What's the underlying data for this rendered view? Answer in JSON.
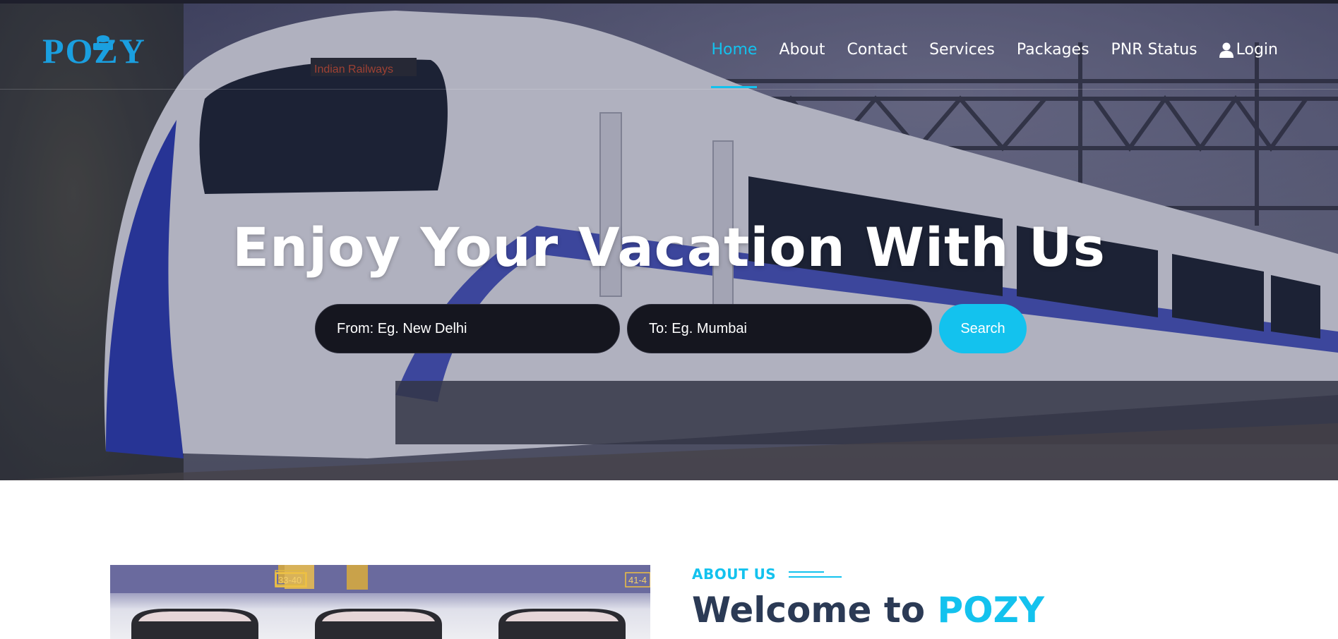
{
  "brand": {
    "logo_text": "POZY",
    "accent": "#13c2ee",
    "logo_color": "#1a9fe0"
  },
  "nav": {
    "items": [
      {
        "label": "Home",
        "active": true
      },
      {
        "label": "About",
        "active": false
      },
      {
        "label": "Contact",
        "active": false
      },
      {
        "label": "Services",
        "active": false
      },
      {
        "label": "Packages",
        "active": false
      },
      {
        "label": "PNR Status",
        "active": false
      }
    ],
    "login_label": "Login",
    "login_icon": "user-icon"
  },
  "hero": {
    "title": "Enjoy Your Vacation With Us",
    "train_sign": "Indian Railways",
    "from_placeholder": "From: Eg. New Delhi",
    "to_placeholder": "To: Eg. Mumbai",
    "search_label": "Search"
  },
  "about": {
    "label": "ABOUT US",
    "heading_prefix": "Welcome to",
    "heading_brand": "POZY",
    "coach_number_left": "33-40",
    "coach_number_right": "41-4"
  }
}
